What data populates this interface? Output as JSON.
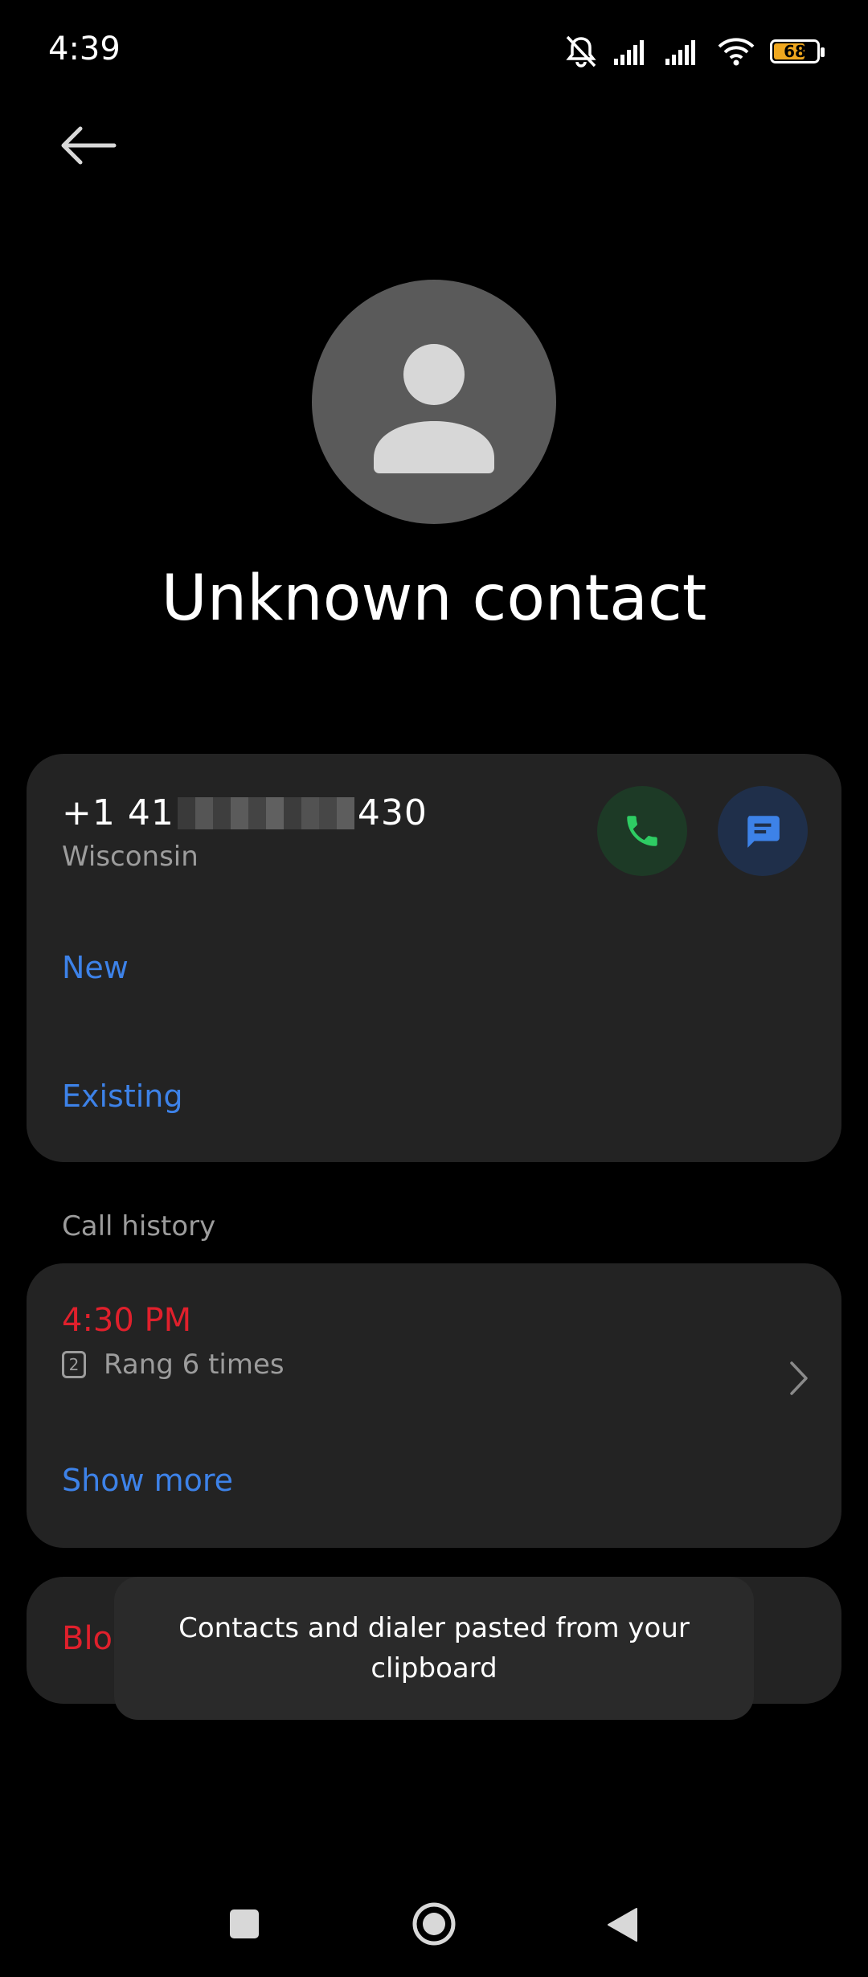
{
  "status_bar": {
    "time": "4:39",
    "battery_level": "68",
    "icons": [
      "mute-icon",
      "signal-icon",
      "signal-icon",
      "wifi-icon",
      "battery-icon"
    ]
  },
  "header": {
    "back_icon": "arrow-left-icon"
  },
  "contact": {
    "name": "Unknown contact",
    "avatar_icon": "person-icon"
  },
  "number_card": {
    "number_prefix": "+1 41",
    "number_suffix": "430",
    "location": "Wisconsin",
    "new_label": "New",
    "existing_label": "Existing",
    "call_icon": "phone-icon",
    "message_icon": "message-icon"
  },
  "call_history": {
    "section_label": "Call history",
    "time": "4:30 PM",
    "sim_slot": "2",
    "rings": "Rang 6 times",
    "show_more_label": "Show more"
  },
  "block": {
    "label": "Bloc"
  },
  "toast": {
    "message": "Contacts and dialer pasted from your clipboard"
  },
  "colors": {
    "background": "#000000",
    "card": "#232323",
    "accent_blue": "#3d82e8",
    "missed_red": "#e0202c",
    "secondary_text": "#9c9c9c",
    "call_green": "#2ecc63"
  }
}
